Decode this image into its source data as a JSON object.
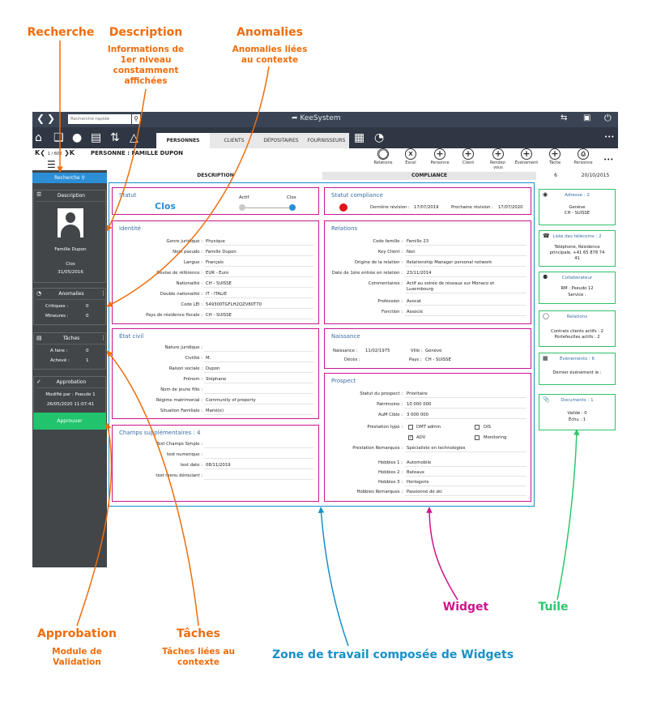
{
  "annotations": {
    "recherche": {
      "title": "Recherche"
    },
    "description": {
      "title": "Description",
      "subtitle_lines": [
        "Informations de",
        "1er niveau",
        "constamment",
        "affichées"
      ]
    },
    "anomalies": {
      "title": "Anomalies",
      "subtitle_lines": [
        "Anomalies liées",
        "au contexte"
      ]
    },
    "approbation": {
      "title": "Approbation",
      "subtitle_lines": [
        "Module de",
        "Validation"
      ]
    },
    "taches": {
      "title": "Tâches",
      "subtitle_lines": [
        "Tâches liées au",
        "contexte"
      ]
    },
    "zone": {
      "title": "Zone de travail composée de Widgets"
    },
    "widget": {
      "title": "Widget"
    },
    "tuile": {
      "title": "Tuile"
    }
  },
  "colors": {
    "orange": "#ee6d0d",
    "teal": "#1690c8",
    "magenta": "#d0138a",
    "green": "#2fc66d",
    "approve": "#21c46d",
    "blue_btn": "#2c8fd6"
  },
  "app": {
    "search_placeholder": "Recherche rapide",
    "brand": "KeeSystem",
    "tabs": [
      {
        "label": "PERSONNES",
        "active": true
      },
      {
        "label": "CLIENTS",
        "active": false
      },
      {
        "label": "DÉPOSITAIRES",
        "active": false
      },
      {
        "label": "FOURNISSEURS",
        "active": false
      }
    ],
    "pager": "1 / 608",
    "record_title": "PERSONNE : FAMILLE DUPON",
    "actions": [
      "Relations",
      "Excel",
      "Personne",
      "Client",
      "Rendez-vous",
      "Événement",
      "Tâche",
      "Personne"
    ],
    "more": "•••",
    "section_tabs": {
      "description": "DESCRIPTION",
      "compliance": "COMPLIANCE",
      "count": "6",
      "date": "20/10/2015"
    }
  },
  "sidebar": {
    "search_button": "Recherche",
    "description": {
      "title": "Description",
      "name": "Famille Dupon",
      "status": "Clos",
      "date": "31/05/2016"
    },
    "anomalies": {
      "title": "Anomalies",
      "rows": [
        {
          "label": "Critiques :",
          "value": "0"
        },
        {
          "label": "Mineures :",
          "value": "0"
        }
      ]
    },
    "taches": {
      "title": "Tâches",
      "rows": [
        {
          "label": "A faire :",
          "value": "0"
        },
        {
          "label": "Achevé :",
          "value": "1"
        }
      ]
    },
    "approbation": {
      "title": "Approbation",
      "modified_by": "Modifié par : Pseudo 1",
      "datetime": "26/05/2020 11:07:41",
      "button": "Approuver"
    }
  },
  "widgets": {
    "statut": {
      "title": "Statut",
      "value": "Clos",
      "actif": "Actif",
      "clos": "Clos"
    },
    "statut_compliance": {
      "title": "Statut compliance",
      "last_rev_label": "Dernière révision :",
      "last_rev": "17/07/2019",
      "next_rev_label": "Prochaine révision :",
      "next_rev": "17/07/2020"
    },
    "identite": {
      "title": "Identité",
      "rows": [
        {
          "label": "Genre juridique :",
          "value": "Physique"
        },
        {
          "label": "Nom pseudo :",
          "value": "Famille Dupon"
        },
        {
          "label": "Langue :",
          "value": "Français"
        },
        {
          "label": "Devise de référence :",
          "value": "EUR - Euro"
        },
        {
          "label": "Nationalité :",
          "value": "CH - SUISSE"
        },
        {
          "label": "Double nationalité :",
          "value": "IT - ITALIE"
        },
        {
          "label": "Code LEI :",
          "value": "549300TGFLH2QZV80T70"
        },
        {
          "label": "Pays de résidence fiscale :",
          "value": "CH - SUISSE"
        }
      ]
    },
    "relations": {
      "title": "Relations",
      "rows": [
        {
          "label": "Code famille :",
          "value": "Famille 23"
        },
        {
          "label": "Key Client :",
          "value": "Non"
        },
        {
          "label": "Origine de la relation :",
          "value": "Relationship Manager personal network"
        },
        {
          "label": "Date de 1ère entrée en relation :",
          "value": "23/11/2014"
        },
        {
          "label": "Commentaires :",
          "value": "Actif au soirée de réseaux sur Monaco et",
          "value2": "Luxembourg"
        },
        {
          "label": "Profession :",
          "value": "Avocat"
        },
        {
          "label": "Fonction :",
          "value": "Associé"
        }
      ]
    },
    "etat_civil": {
      "title": "État civil",
      "rows": [
        {
          "label": "Nature juridique :",
          "value": ""
        },
        {
          "label": "Civilité :",
          "value": "M."
        },
        {
          "label": "Raison sociale :",
          "value": "Dupon"
        },
        {
          "label": "Prénom :",
          "value": "Stéphane"
        },
        {
          "label": "Nom de jeune fille :",
          "value": ""
        },
        {
          "label": "Régime matrimonial :",
          "value": "Community of property"
        },
        {
          "label": "Situation Familiale :",
          "value": "Marié(e)"
        }
      ]
    },
    "naissance": {
      "title": "Naissance",
      "birth_label": "Naissance :",
      "birth": "11/02/1975",
      "city_label": "Ville :",
      "city": "Genève",
      "death_label": "Décès :",
      "country_label": "Pays :",
      "country": "CH - SUISSE"
    },
    "champs": {
      "title": "Champs supplémentaires : 4",
      "rows": [
        {
          "label": "Text Champs Simple :",
          "value": ""
        },
        {
          "label": "test numerique :",
          "value": ""
        },
        {
          "label": "test date :",
          "value": "08/11/2019"
        },
        {
          "label": "test menu déroulant :",
          "value": ""
        }
      ]
    },
    "prospect": {
      "title": "Prospect",
      "rows": [
        {
          "label": "Statut du prospect :",
          "value": "Prioritaire"
        },
        {
          "label": "Patrimoine :",
          "value": "10 000 000"
        },
        {
          "label": "AuM Cible :",
          "value": "3 000 000"
        }
      ],
      "prestation_label": "Prestation type :",
      "options": [
        {
          "label": "DMT admin",
          "checked": false
        },
        {
          "label": "DIS",
          "checked": false
        },
        {
          "label": "ADV",
          "checked": true
        },
        {
          "label": "Monitoring",
          "checked": false
        }
      ],
      "remarks_label": "Prestation Remarques :",
      "remarks": "Spécialiste en technologies",
      "hobbies": [
        {
          "label": "Hobbies 1 :",
          "value": "Automobile"
        },
        {
          "label": "Hobbies 2 :",
          "value": "Bateaux"
        },
        {
          "label": "Hobbies 3 :",
          "value": "Horlogerie"
        },
        {
          "label": "Hobbies Remarques :",
          "value": "Passionné de ski"
        }
      ]
    }
  },
  "tiles": {
    "adresse": {
      "title": "Adresse : 2",
      "line1": "Genève",
      "line2": "CH - SUISSE"
    },
    "telecoms": {
      "title": "Liste des télécoms : 2",
      "line1": "Téléphone, Résidence",
      "line2": "principale, +41 65 878 74",
      "line3": "41"
    },
    "collaborateur": {
      "title": "Collaborateur",
      "line1": "RM : Pseudo 12",
      "line2": "Service :"
    },
    "relations": {
      "title": "Relations",
      "line1": "Contrats clients actifs : 2",
      "line2": "Portefeuilles actifs : 2"
    },
    "evenements": {
      "title": "Événements : 6",
      "line1": "Dernier événement le :"
    },
    "documents": {
      "title": "Documents : 1",
      "line1": "Validé : 0",
      "line2": "Échu : 1"
    }
  }
}
